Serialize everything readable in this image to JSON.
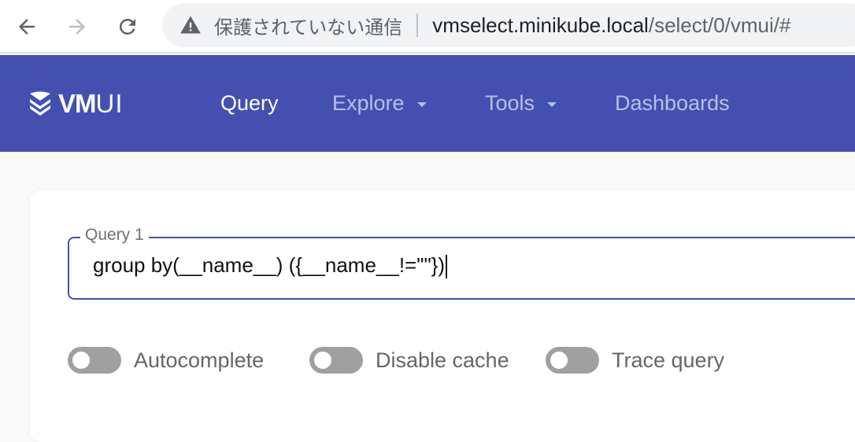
{
  "browser": {
    "security_text": "保護されていない通信",
    "url_host": "vmselect.minikube.local",
    "url_path": "/select/0/vmui/#",
    "icons": {
      "back": "arrow-left-icon",
      "forward": "arrow-right-icon",
      "reload": "reload-icon",
      "security": "warning-triangle-icon"
    }
  },
  "header": {
    "logo_bold": "VM",
    "logo_light": "UI",
    "nav": [
      {
        "label": "Query",
        "active": true,
        "dropdown": false
      },
      {
        "label": "Explore",
        "active": false,
        "dropdown": true
      },
      {
        "label": "Tools",
        "active": false,
        "dropdown": true
      },
      {
        "label": "Dashboards",
        "active": false,
        "dropdown": false
      }
    ],
    "colors": {
      "background": "#4450b0",
      "active_text": "#ffffff",
      "inactive_text": "#b9bfe6"
    }
  },
  "query_panel": {
    "query_label": "Query 1",
    "query_value": "group by(__name__) ({__name__!=\"\"})",
    "toggles": [
      {
        "label": "Autocomplete",
        "on": false
      },
      {
        "label": "Disable cache",
        "on": false
      },
      {
        "label": "Trace query",
        "on": false
      }
    ]
  }
}
